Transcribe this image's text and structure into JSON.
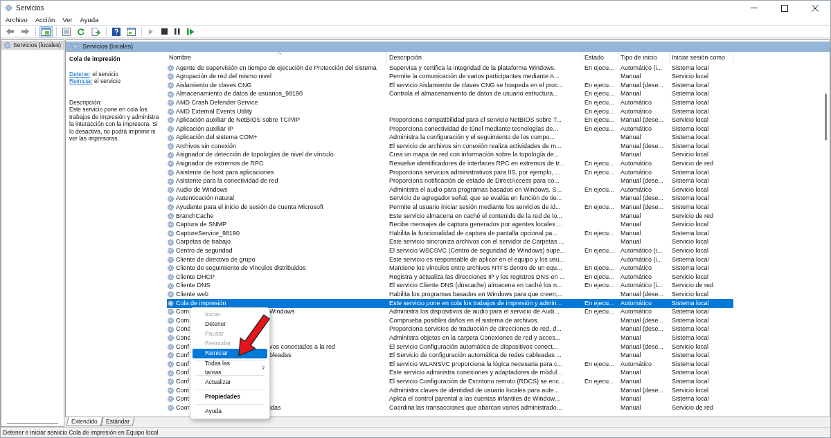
{
  "window": {
    "title": "Servicios"
  },
  "menu": [
    "Archivo",
    "Acción",
    "Ver",
    "Ayuda"
  ],
  "toolbar": [
    {
      "kind": "back",
      "selected": false,
      "disabled": false
    },
    {
      "kind": "forward",
      "selected": false,
      "disabled": false
    },
    {
      "kind": "separator"
    },
    {
      "kind": "tree",
      "selected": true,
      "disabled": false
    },
    {
      "kind": "separator"
    },
    {
      "kind": "properties",
      "selected": false,
      "disabled": false
    },
    {
      "kind": "refresh",
      "selected": false,
      "disabled": false
    },
    {
      "kind": "export",
      "selected": false,
      "disabled": false
    },
    {
      "kind": "separator"
    },
    {
      "kind": "help",
      "selected": false,
      "disabled": false
    },
    {
      "kind": "view",
      "selected": false,
      "disabled": false
    },
    {
      "kind": "separator"
    },
    {
      "kind": "play",
      "selected": false,
      "disabled": true
    },
    {
      "kind": "stop",
      "selected": false,
      "disabled": false
    },
    {
      "kind": "pause",
      "selected": false,
      "disabled": false
    },
    {
      "kind": "resume",
      "selected": false,
      "disabled": false
    }
  ],
  "tree": [
    {
      "label": "Servicios (locales)",
      "selected": true
    }
  ],
  "pane_header": "Servicios (locales)",
  "details": {
    "title": "Cola de impresión",
    "actions": [
      {
        "link": "Detener",
        "text": "el servicio"
      },
      {
        "link": "Reiniciar",
        "text": "el servicio"
      }
    ],
    "description_label": "Descripción:",
    "description": "Este servicio pone en cola los trabajos de impresión y administra la interacción con la impresora. Si lo desactiva, no podrá imprimir ni ver las impresoras."
  },
  "table": {
    "columns": [
      {
        "label": "Nombre",
        "sorted": true
      },
      {
        "label": "Descripción",
        "sorted": false
      },
      {
        "label": "Estado",
        "sorted": false
      },
      {
        "label": "Tipo de inicio",
        "sorted": false
      },
      {
        "label": "Iniciar sesión como",
        "sorted": false
      }
    ],
    "rows": [
      {
        "name": "Agente de supervisión en tiempo de ejecución de Protección del sistema",
        "description": "Supervisa y certifica la integridad de la plataforma Windows.",
        "status": "En ejecu...",
        "startup": "Automático (i...",
        "logon": "Sistema local",
        "selected": false
      },
      {
        "name": "Agrupación de red del mismo nivel",
        "description": "Permite la comunicación de varios participantes mediante A...",
        "startup": "Manual",
        "logon": "Servicio local",
        "selected": false
      },
      {
        "name": "Aislamiento de claves CNG",
        "description": "El servicio Aislamiento de claves CNG se hospeda en el proc...",
        "status": "En ejecu...",
        "startup": "Manual (dese...",
        "logon": "Sistema local",
        "selected": false
      },
      {
        "name": "Almacenamiento de datos de usuarios_98190",
        "description": "Controla el almacenamiento de datos de usuario estructura...",
        "status": "En ejecu...",
        "startup": "Manual",
        "logon": "Sistema local",
        "selected": false
      },
      {
        "name": "AMD Crash Defender Service",
        "status": "En ejecu...",
        "startup": "Automático",
        "logon": "Sistema local",
        "selected": false
      },
      {
        "name": "AMD External Events Utility",
        "status": "En ejecu...",
        "startup": "Automático",
        "logon": "Sistema local",
        "selected": false
      },
      {
        "name": "Aplicación auxiliar de NetBIOS sobre TCP/IP",
        "description": "Proporciona compatibilidad para el servicio NetBIOS sobre T...",
        "status": "En ejecu...",
        "startup": "Manual (dese...",
        "logon": "Servicio local",
        "selected": false
      },
      {
        "name": "Aplicación auxiliar IP",
        "description": "Proporciona conectividad de túnel mediante tecnologías de...",
        "status": "En ejecu...",
        "startup": "Automático",
        "logon": "Sistema local",
        "selected": false
      },
      {
        "name": "Aplicación del sistema COM+",
        "description": "Administra la configuración y el seguimiento de los compo...",
        "startup": "Manual",
        "logon": "Sistema local",
        "selected": false
      },
      {
        "name": "Archivos sin conexión",
        "description": "El servicio de archivos sin conexión realiza actividades de m...",
        "startup": "Manual (dese...",
        "logon": "Sistema local",
        "selected": false
      },
      {
        "name": "Asignador de detección de topologías de nivel de vínculo",
        "description": "Crea un mapa de red con información sobre la topología de...",
        "startup": "Manual",
        "logon": "Servicio local",
        "selected": false
      },
      {
        "name": "Asignador de extremos de RPC",
        "description": "Resuelve identificadores de interfaces RPC en extremos de tr...",
        "status": "En ejecu...",
        "startup": "Automático",
        "logon": "Servicio de red",
        "selected": false
      },
      {
        "name": "Asistente de host para aplicaciones",
        "description": "Proporciona servicios administrativos para IIS, por ejemplo, ...",
        "status": "En ejecu...",
        "startup": "Automático",
        "logon": "Sistema local",
        "selected": false
      },
      {
        "name": "Asistente para la conectividad de red",
        "description": "Proporciona notificación de estado de DirectAccess para co...",
        "startup": "Manual (dese...",
        "logon": "Sistema local",
        "selected": false
      },
      {
        "name": "Audio de Windows",
        "description": "Administra el audio para programas basados en Windows. S...",
        "status": "En ejecu...",
        "startup": "Automático",
        "logon": "Servicio local",
        "selected": false
      },
      {
        "name": "Autenticación natural",
        "description": "Servicio de agregador señal, que se evalúa en función de tie...",
        "startup": "Manual (dese...",
        "logon": "Sistema local",
        "selected": false
      },
      {
        "name": "Ayudante para el inicio de sesión de cuenta Microsoft",
        "description": "Permite al usuario iniciar sesión mediante los servicios de id...",
        "status": "En ejecu...",
        "startup": "Manual (dese...",
        "logon": "Sistema local",
        "selected": false
      },
      {
        "name": "BranchCache",
        "description": "Este servicio almacena en caché el contenido de la red de lo...",
        "startup": "Manual",
        "logon": "Servicio de red",
        "selected": false
      },
      {
        "name": "Captura de SNMP",
        "description": "Recibe mensajes de captura generados por agentes locales ...",
        "startup": "Manual",
        "logon": "Servicio local",
        "selected": false
      },
      {
        "name": "CaptureService_98190",
        "description": "Habilita la funcionalidad de captura de pantalla opcional pa...",
        "status": "En ejecu...",
        "startup": "Manual",
        "logon": "Sistema local",
        "selected": false
      },
      {
        "name": "Carpetas de trabajo",
        "description": "Este servicio sincroniza archivos con el servidor de Carpetas ...",
        "startup": "Manual",
        "logon": "Servicio local",
        "selected": false
      },
      {
        "name": "Centro de seguridad",
        "description": "El servicio WSCSVC (Centro de seguridad de Windows) supe...",
        "status": "En ejecu...",
        "startup": "Automático (i...",
        "logon": "Servicio local",
        "selected": false
      },
      {
        "name": "Cliente de directiva de grupo",
        "description": "Este servicio es responsable de aplicar en el equipo y los usu...",
        "startup": "Automático (i...",
        "logon": "Sistema local",
        "selected": false
      },
      {
        "name": "Cliente de seguimiento de vínculos distribuidos",
        "description": "Mantiene los vínculos entre archivos NTFS dentro de un equ...",
        "status": "En ejecu...",
        "startup": "Automático",
        "logon": "Sistema local",
        "selected": false
      },
      {
        "name": "Cliente DHCP",
        "description": "Registra y actualiza las direcciones IP y los registros DNS en ...",
        "status": "En ejecu...",
        "startup": "Automático",
        "logon": "Servicio local",
        "selected": false
      },
      {
        "name": "Cliente DNS",
        "description": "El servicio Cliente DNS (dnscache) almacena en caché los n...",
        "status": "En ejecu...",
        "startup": "Automático (i...",
        "logon": "Servicio de red",
        "selected": false
      },
      {
        "name": "Cliente web",
        "description": "Habilita los programas basados en Windows para que creen,...",
        "startup": "Manual (dese...",
        "logon": "Servicio local",
        "selected": false
      },
      {
        "name": "Cola de impresión",
        "description": "Este servicio pone en cola los trabajos de impresión y admin...",
        "status": "En ejecu...",
        "startup": "Automático",
        "logon": "Sistema local",
        "selected": true
      },
      {
        "name": "Com",
        "name_tail": "Windows",
        "description": "Administra los dispositivos de audio para el servicio de Audi...",
        "status": "En ejecu...",
        "startup": "Automático",
        "logon": "Sistema local",
        "selected": false
      },
      {
        "name": "Com",
        "description": "Comprueba posibles daños en el sistema de archivos.",
        "startup": "Manual (dese...",
        "logon": "Sistema local",
        "selected": false
      },
      {
        "name": "Cone",
        "description": "Proporciona servicios de traducción de direcciones de red, d...",
        "startup": "Manual (dese...",
        "logon": "Sistema local",
        "selected": false
      },
      {
        "name": "Cone",
        "description": "Administra objetos en la carpeta Conexiones de red y acces...",
        "startup": "Manual",
        "logon": "Sistema local",
        "selected": false
      },
      {
        "name": "Conf",
        "name_tail": "vos conectados a la red",
        "description": "El servicio Configuración automática de dispositivos conect...",
        "startup": "Manual (dese...",
        "logon": "Servicio local",
        "selected": false
      },
      {
        "name": "Conf",
        "name_tail": "bleadas",
        "description": "El Servicio de configuración automática de redes cableadas ...",
        "startup": "Manual",
        "logon": "Sistema local",
        "selected": false
      },
      {
        "name": "Conf",
        "description": "El servicio WLANSVC proporciona la lógica necesaria para c...",
        "status": "En ejecu...",
        "startup": "Automático",
        "logon": "Sistema local",
        "selected": false
      },
      {
        "name": "Conf",
        "description": "Este servicio administra conexiones y adaptadores de módul...",
        "startup": "Manual",
        "logon": "Sistema local",
        "selected": false
      },
      {
        "name": "Conf",
        "description": "El servicio Configuración de Escritorio remoto (RDCS) se enc...",
        "status": "En ejecu...",
        "startup": "Manual",
        "logon": "Sistema local",
        "selected": false
      },
      {
        "name": "Cont",
        "description": "Administra claves de identidad de usuario locales para aute...",
        "startup": "Manual (dese...",
        "logon": "Servicio local",
        "selected": false
      },
      {
        "name": "Cont",
        "description": "Aplica el control parental a las cuentas infantiles de Window...",
        "startup": "Manual",
        "logon": "Sistema local",
        "selected": false
      },
      {
        "name": "Coor",
        "name_tail": "idas",
        "description": "Coordina las transacciones que abarcan varios administrado...",
        "startup": "Manual",
        "logon": "Servicio de red",
        "selected": false
      }
    ]
  },
  "context_menu": [
    {
      "kind": "item",
      "label": "Iniciar",
      "disabled": true,
      "selected": false
    },
    {
      "kind": "item",
      "label": "Detener",
      "disabled": false,
      "selected": false
    },
    {
      "kind": "item",
      "label": "Pausar",
      "disabled": true,
      "selected": false
    },
    {
      "kind": "item",
      "label": "Reanudar",
      "disabled": true,
      "selected": false
    },
    {
      "kind": "item",
      "label": "Reiniciar",
      "disabled": false,
      "selected": true
    },
    {
      "kind": "separator"
    },
    {
      "kind": "submenu",
      "label": "Todas las tareas",
      "disabled": false,
      "selected": false
    },
    {
      "kind": "separator"
    },
    {
      "kind": "item",
      "label": "Actualizar",
      "disabled": false,
      "selected": false
    },
    {
      "kind": "separator"
    },
    {
      "kind": "default",
      "label": "Propiedades",
      "disabled": false,
      "selected": false
    },
    {
      "kind": "separator"
    },
    {
      "kind": "item",
      "label": "Ayuda",
      "disabled": false,
      "selected": false
    }
  ],
  "tabs": [
    {
      "label": "Extendido",
      "selected": true
    },
    {
      "label": "Estándar",
      "selected": false
    }
  ],
  "status_bar": "Detener e iniciar servicio Cola de impresión en Equipo local"
}
